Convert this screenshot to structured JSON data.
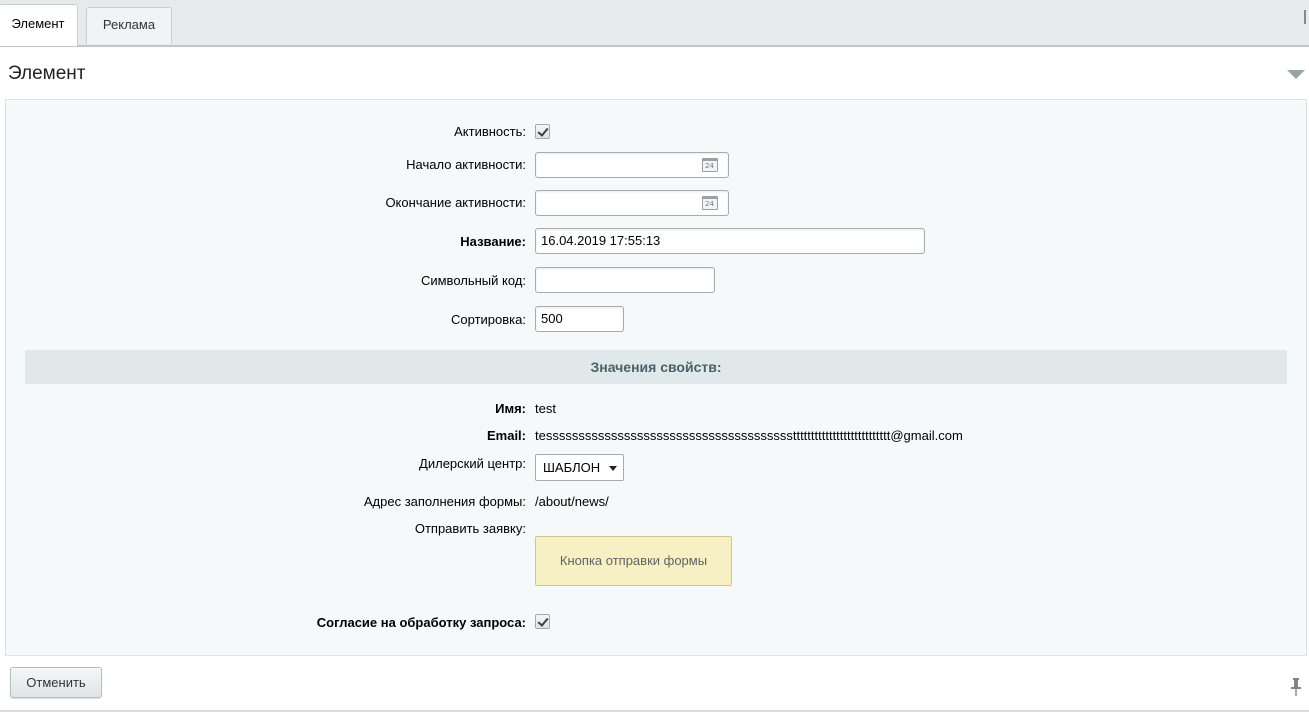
{
  "tabs": [
    {
      "label": "Элемент",
      "active": true
    },
    {
      "label": "Реклама",
      "active": false
    }
  ],
  "section": {
    "title": "Элемент"
  },
  "form": {
    "active_label": "Активность:",
    "active_checked": true,
    "start_label": "Начало активности:",
    "start_value": "",
    "end_label": "Окончание активности:",
    "end_value": "",
    "calendar_text": "24",
    "name_label": "Название:",
    "name_value": "16.04.2019 17:55:13",
    "code_label": "Символьный код:",
    "code_value": "",
    "sort_label": "Сортировка:",
    "sort_value": "500"
  },
  "properties": {
    "header": "Значения свойств:",
    "name_label": "Имя:",
    "name_value": "test",
    "email_label": "Email:",
    "email_value": "tessssssssssssssssssssssssssssssssssssssttttttttttttttttttttttttttt@gmail.com",
    "dealer_label": "Дилерский центр:",
    "dealer_value": "ШАБЛОН",
    "address_label": "Адрес заполнения формы:",
    "address_value": "/about/news/",
    "send_label": "Отправить заявку:",
    "send_button": "Кнопка отправки формы",
    "consent_label": "Согласие на обработку запроса:",
    "consent_checked": true
  },
  "footer": {
    "cancel_label": "Отменить"
  },
  "colors": {
    "panel_bg": "#f5f9f9",
    "props_header_bg": "#e0e8ea",
    "send_button_bg": "#f6f0c4"
  }
}
